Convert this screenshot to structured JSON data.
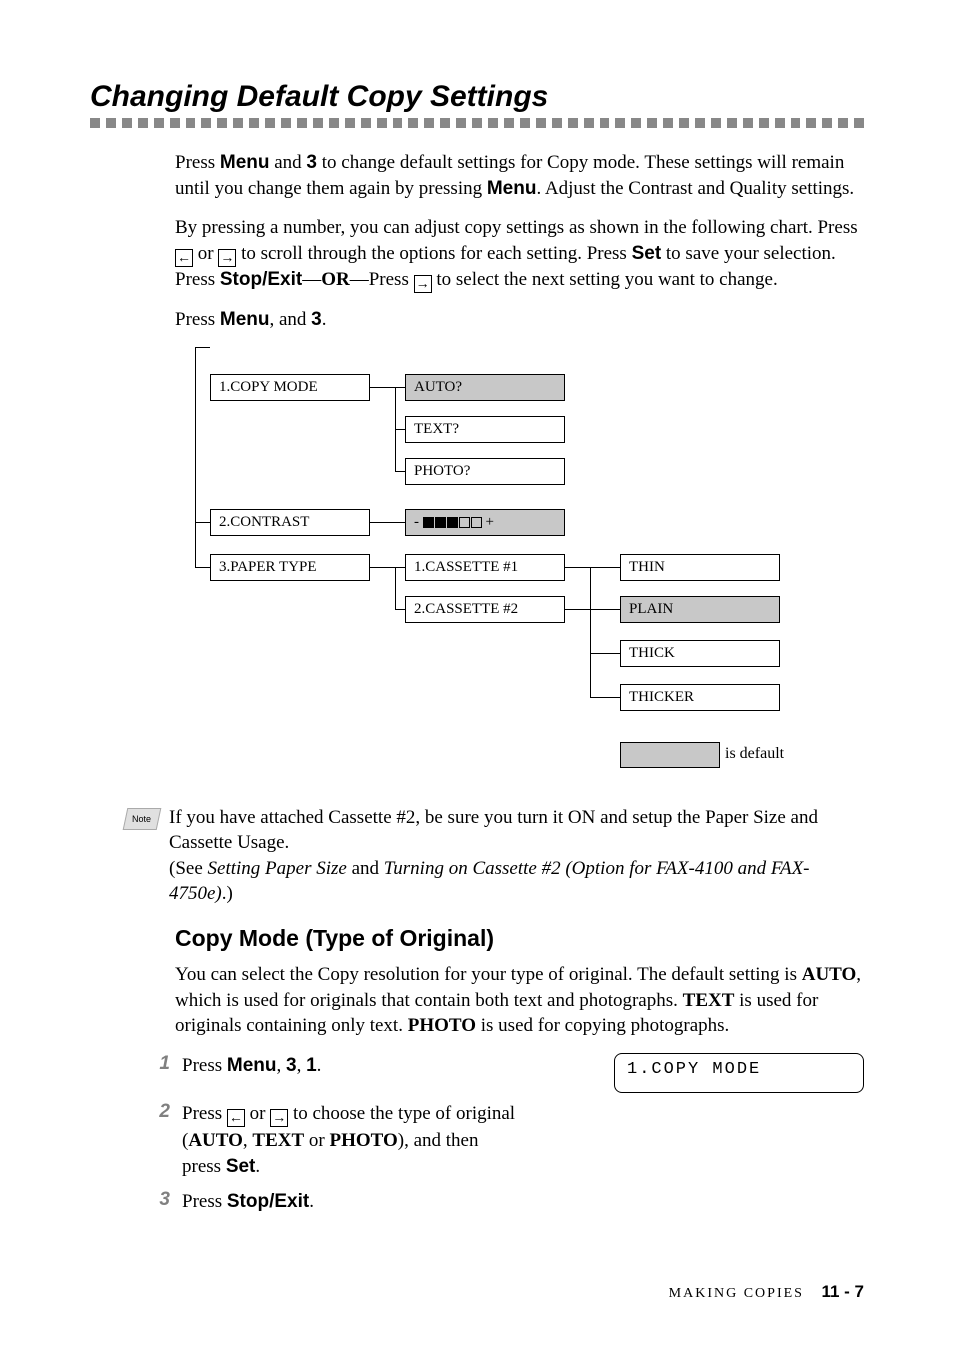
{
  "title": "Changing Default Copy Settings",
  "para1_a": "Press ",
  "para1_b": "Menu",
  "para1_c": " and ",
  "para1_d": "3",
  "para1_e": " to change default settings for Copy mode. These settings will remain until you change them again by pressing ",
  "para1_f": "Menu",
  "para1_g": ". Adjust the  Contrast and Quality settings.",
  "para2_a": "By pressing a number, you can adjust copy settings as shown in the following chart. Press ",
  "para2_b": " or ",
  "para2_c": " to scroll through the options for each setting. Press ",
  "para2_d": "Set",
  "para2_e": " to save your selection. Press ",
  "para2_f": "Stop/Exit",
  "para2_g": "—",
  "para2_h": "OR",
  "para2_i": "—Press ",
  "para2_j": " to select the next setting you want to change.",
  "para3_a": "Press ",
  "para3_b": "Menu",
  "para3_c": ", and ",
  "para3_d": "3",
  "para3_e": ".",
  "diagram": {
    "copy_mode": "1.COPY MODE",
    "auto": "AUTO?",
    "text": "TEXT?",
    "photo": "PHOTO?",
    "contrast": "2.CONTRAST",
    "contrast_val_minus": "-",
    "contrast_val_plus": "+",
    "paper_type": "3.PAPER TYPE",
    "cass1": "1.CASSETTE #1",
    "cass2": "2.CASSETTE #2",
    "thin": "THIN",
    "plain": "PLAIN",
    "thick": "THICK",
    "thicker": "THICKER",
    "legend": " is default"
  },
  "note_label": "Note",
  "note_a": "If you have attached Cassette #2, be sure you turn it ON and setup the Paper Size and Cassette Usage.",
  "note_b": "(See ",
  "note_c": "Setting Paper Size",
  "note_d": " and ",
  "note_e": "Turning on Cassette #2 (Option for FAX-4100 and FAX-4750e)",
  "note_f": ".)",
  "subhead": "Copy Mode (Type of Original)",
  "sub_para_a": "You can select the Copy resolution for your type of original. The default setting is ",
  "sub_para_b": "AUTO",
  "sub_para_c": ", which is used for originals that contain both text and photographs. ",
  "sub_para_d": "TEXT",
  "sub_para_e": " is used for originals containing only text. ",
  "sub_para_f": "PHOTO",
  "sub_para_g": " is used for copying photographs.",
  "step1_num": "1",
  "step1_a": "Press ",
  "step1_b": "Menu",
  "step1_c": ", ",
  "step1_d": "3",
  "step1_e": ", ",
  "step1_f": "1",
  "step1_g": ".",
  "lcd_text": "1.COPY MODE",
  "step2_num": "2",
  "step2_a": "Press ",
  "step2_b": " or ",
  "step2_c": " to choose the type of original (",
  "step2_d": "AUTO",
  "step2_e": ", ",
  "step2_f": "TEXT",
  "step2_g": " or ",
  "step2_h": "PHOTO",
  "step2_i": "), and then press ",
  "step2_j": "Set",
  "step2_k": ".",
  "step3_num": "3",
  "step3_a": "Press ",
  "step3_b": "Stop/Exit",
  "step3_c": ".",
  "footer_text": "MAKING COPIES",
  "footer_page": "11 - 7",
  "arrow_left": "←",
  "arrow_right": "→"
}
